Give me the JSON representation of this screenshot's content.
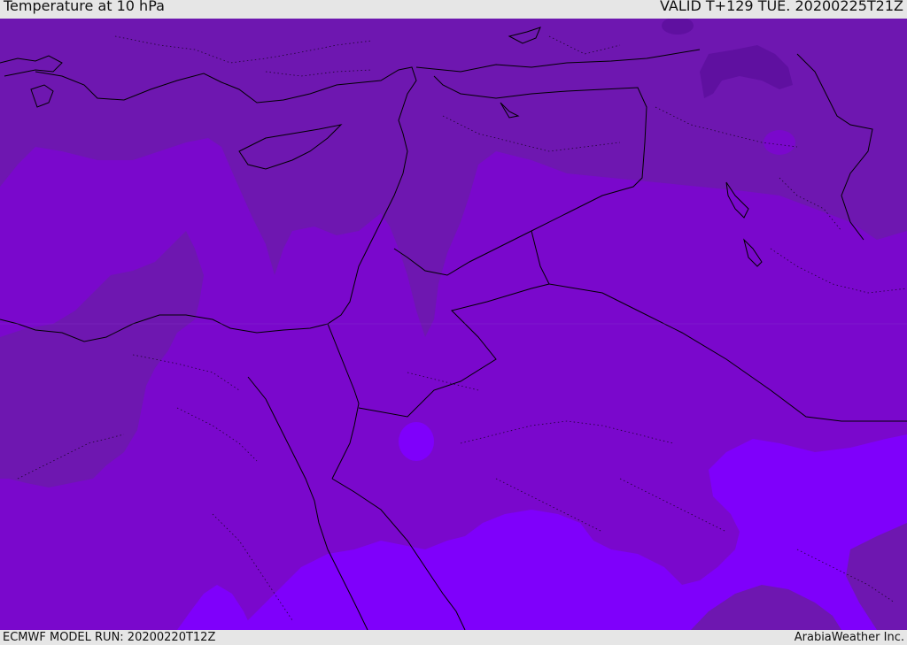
{
  "header": {
    "title": "Temperature at 10 hPa",
    "valid": "VALID T+129 TUE. 20200225T21Z"
  },
  "footer": {
    "model_run": "ECMWF MODEL RUN: 20200220T12Z",
    "credit": "ArabiaWeather Inc."
  },
  "colors": {
    "dark_band": "#6e17b0",
    "mid_band": "#7a08cc",
    "light_band": "#7f00fb",
    "deep_patch": "#5f10a0",
    "coast": "#000000",
    "bar_bg": "#e6e6e6"
  }
}
